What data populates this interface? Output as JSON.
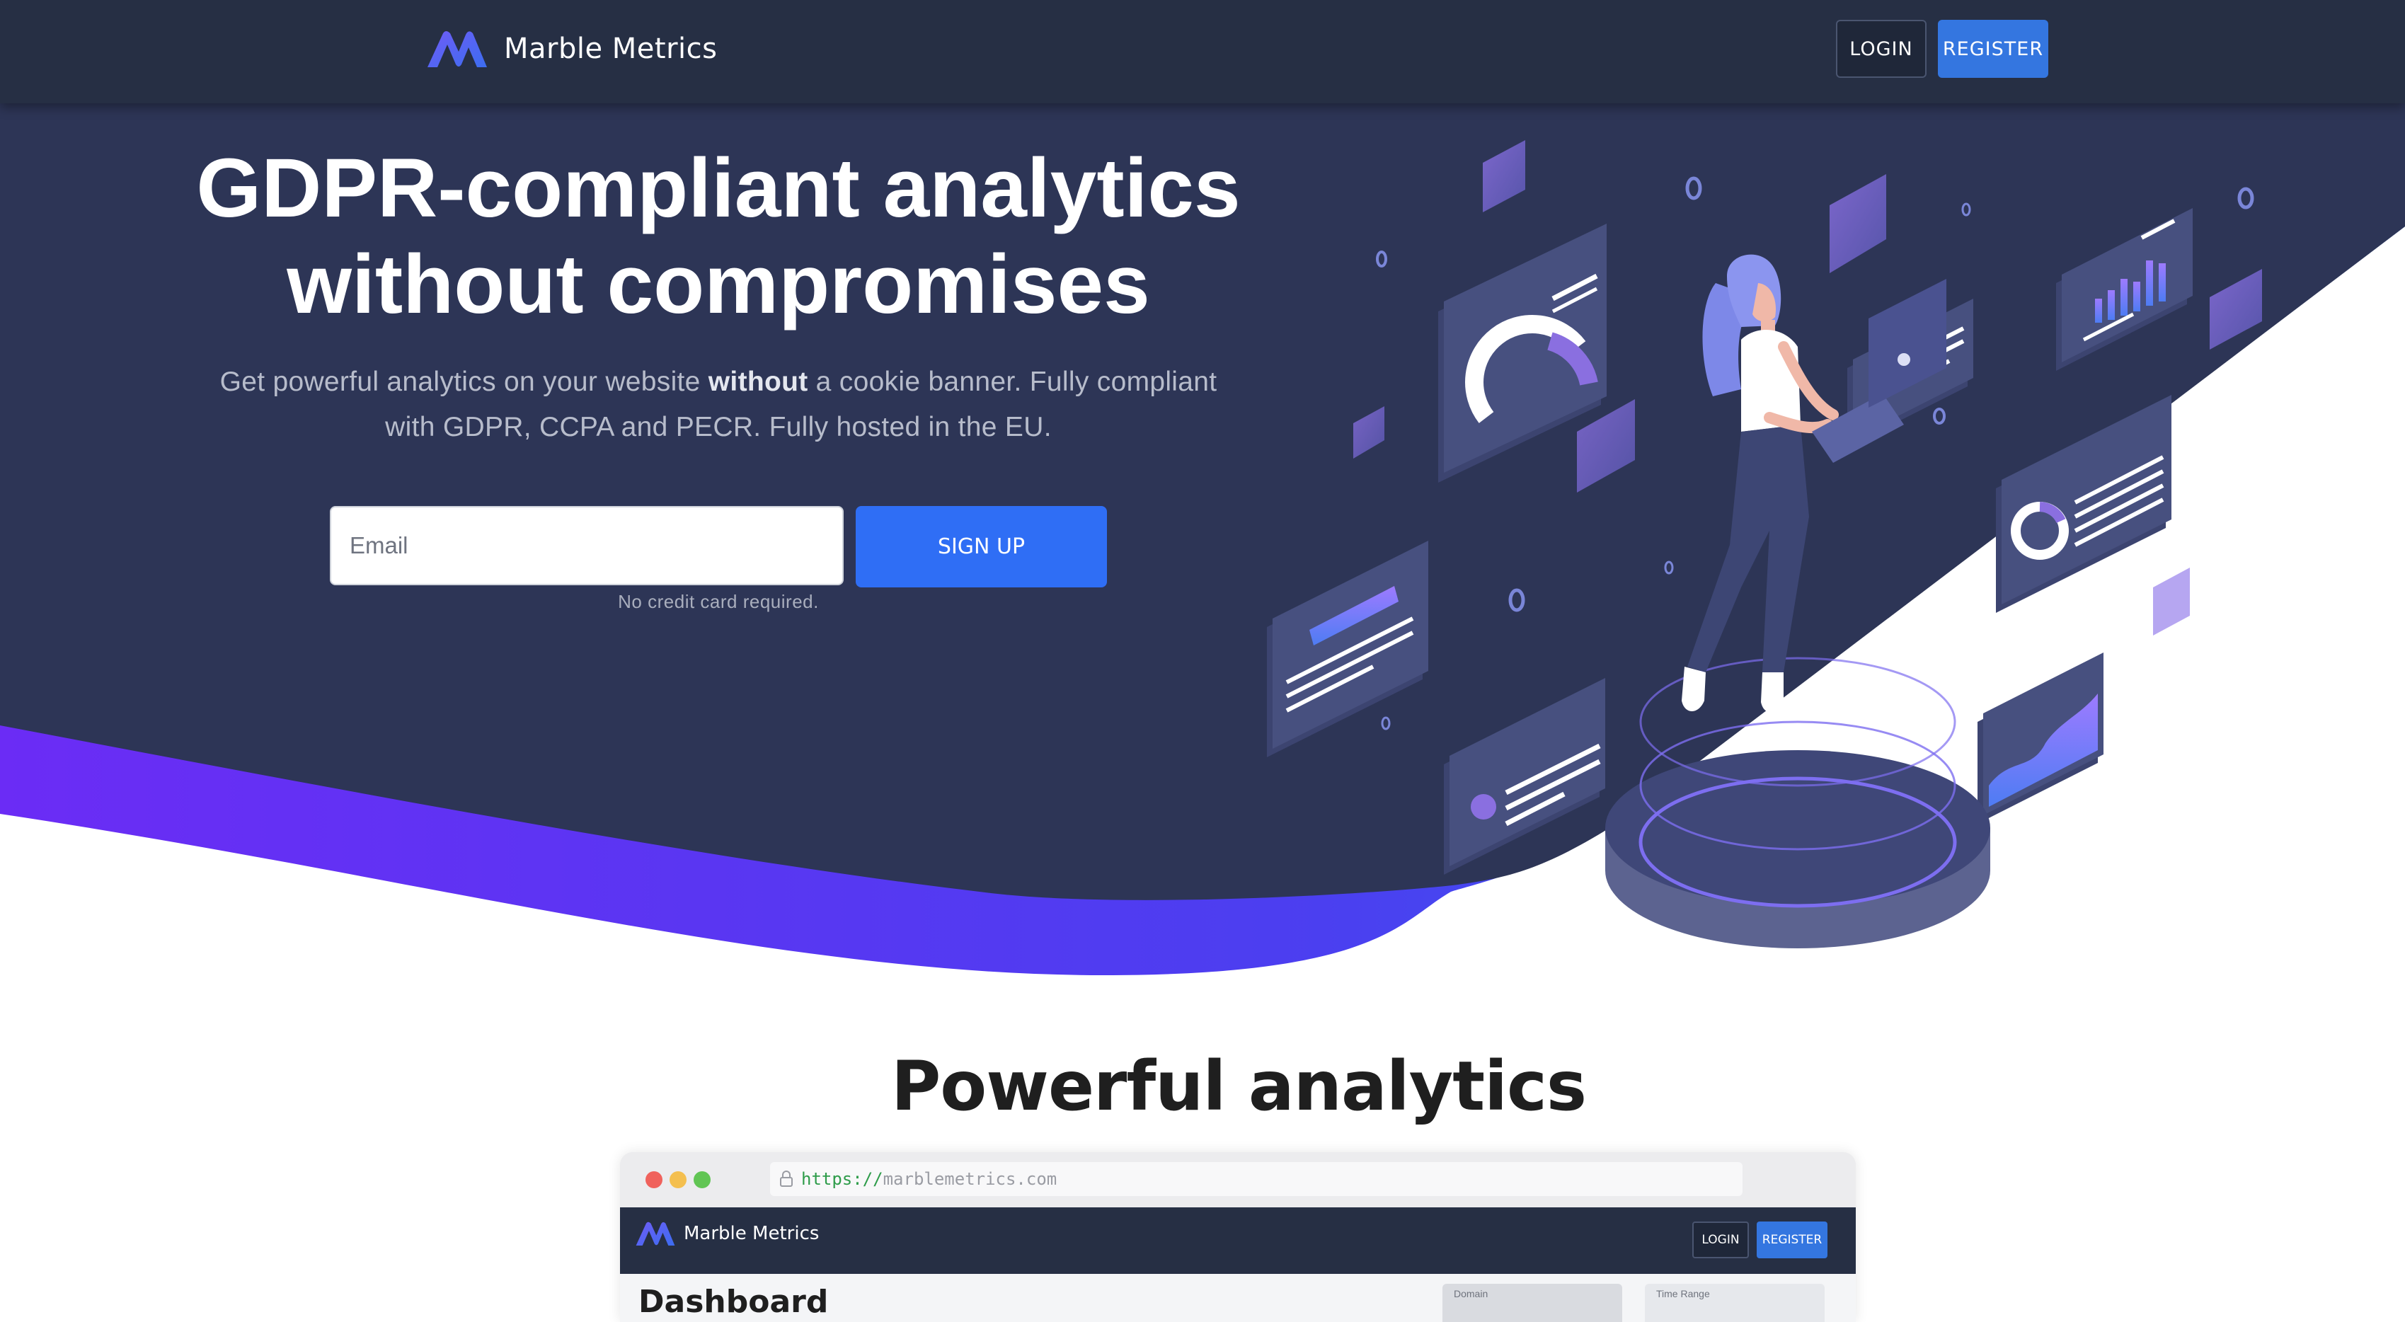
{
  "navbar": {
    "brand_name": "Marble Metrics",
    "login_label": "LOGIN",
    "register_label": "REGISTER"
  },
  "hero": {
    "title_line1": "GDPR-compliant analytics",
    "title_line2": "without compromises",
    "subtitle_part1": "Get powerful analytics on your website ",
    "subtitle_emphasis": "without",
    "subtitle_part2": " a cookie banner. Fully compliant with GDPR, CCPA and PECR. Fully hosted in the EU.",
    "email_placeholder": "Email",
    "signup_label": "SIGN UP",
    "note": "No credit card required."
  },
  "features": {
    "heading": "Powerful analytics"
  },
  "mockup": {
    "url_scheme": "https://",
    "url_host": "marblemetrics.com",
    "brand_name": "Marble Metrics",
    "login_label": "LOGIN",
    "register_label": "REGISTER",
    "page_title": "Dashboard",
    "domain_label": "Domain",
    "range_label": "Time Range"
  },
  "colors": {
    "navbar": "#262f44",
    "hero_bg": "#2d3556",
    "accent_blue": "#2f6ef5",
    "wave_start": "#6b2cf5",
    "wave_end": "#2f6ef5"
  }
}
